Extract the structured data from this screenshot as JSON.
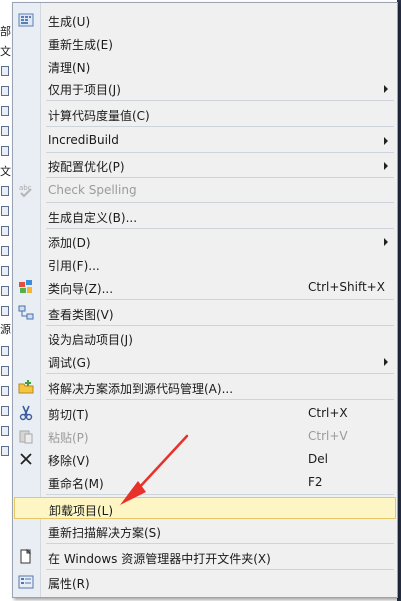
{
  "background": {
    "fragments": [
      "部",
      "文",
      "文",
      "源"
    ]
  },
  "menu": {
    "items": [
      {
        "label": "生成(U)",
        "icon": "build-icon",
        "shortcut": "",
        "submenu": false,
        "disabled": false
      },
      {
        "label": "重新生成(E)",
        "icon": "",
        "shortcut": "",
        "submenu": false,
        "disabled": false
      },
      {
        "label": "清理(N)",
        "icon": "",
        "shortcut": "",
        "submenu": false,
        "disabled": false
      },
      {
        "label": "仅用于项目(J)",
        "icon": "",
        "shortcut": "",
        "submenu": true,
        "disabled": false
      },
      {
        "label": "计算代码度量值(C)",
        "icon": "",
        "shortcut": "",
        "submenu": false,
        "disabled": false
      },
      {
        "label": "IncrediBuild",
        "icon": "",
        "shortcut": "",
        "submenu": true,
        "disabled": false
      },
      {
        "label": "按配置优化(P)",
        "icon": "",
        "shortcut": "",
        "submenu": true,
        "disabled": false
      },
      {
        "label": "Check Spelling",
        "icon": "spellcheck-icon",
        "shortcut": "",
        "submenu": false,
        "disabled": true
      },
      {
        "label": "生成自定义(B)...",
        "icon": "",
        "shortcut": "",
        "submenu": false,
        "disabled": false
      },
      {
        "label": "添加(D)",
        "icon": "",
        "shortcut": "",
        "submenu": true,
        "disabled": false
      },
      {
        "label": "引用(F)...",
        "icon": "",
        "shortcut": "",
        "submenu": false,
        "disabled": false
      },
      {
        "label": "类向导(Z)...",
        "icon": "class-wizard-icon",
        "shortcut": "Ctrl+Shift+X",
        "submenu": false,
        "disabled": false
      },
      {
        "label": "查看类图(V)",
        "icon": "class-diagram-icon",
        "shortcut": "",
        "submenu": false,
        "disabled": false
      },
      {
        "label": "设为启动项目(J)",
        "icon": "",
        "shortcut": "",
        "submenu": false,
        "disabled": false
      },
      {
        "label": "调试(G)",
        "icon": "",
        "shortcut": "",
        "submenu": true,
        "disabled": false
      },
      {
        "label": "将解决方案添加到源代码管理(A)...",
        "icon": "source-control-folder-icon",
        "shortcut": "",
        "submenu": false,
        "disabled": false
      },
      {
        "label": "剪切(T)",
        "icon": "scissors-icon",
        "shortcut": "Ctrl+X",
        "submenu": false,
        "disabled": false
      },
      {
        "label": "粘贴(P)",
        "icon": "paste-icon",
        "shortcut": "Ctrl+V",
        "submenu": false,
        "disabled": true
      },
      {
        "label": "移除(V)",
        "icon": "close-icon",
        "shortcut": "Del",
        "submenu": false,
        "disabled": false
      },
      {
        "label": "重命名(M)",
        "icon": "",
        "shortcut": "F2",
        "submenu": false,
        "disabled": false
      },
      {
        "label": "卸载项目(L)",
        "icon": "",
        "shortcut": "",
        "submenu": false,
        "disabled": false,
        "highlighted": true
      },
      {
        "label": "重新扫描解决方案(S)",
        "icon": "",
        "shortcut": "",
        "submenu": false,
        "disabled": false
      },
      {
        "label": "在 Windows 资源管理器中打开文件夹(X)",
        "icon": "open-folder-icon",
        "shortcut": "",
        "submenu": false,
        "disabled": false
      },
      {
        "label": "属性(R)",
        "icon": "properties-icon",
        "shortcut": "",
        "submenu": false,
        "disabled": false
      }
    ]
  },
  "colors": {
    "highlight_bg": "#fdf6c4",
    "highlight_border": "#e8c864",
    "arrow": "#e8312a",
    "disabled_text": "#9b9b9b"
  }
}
